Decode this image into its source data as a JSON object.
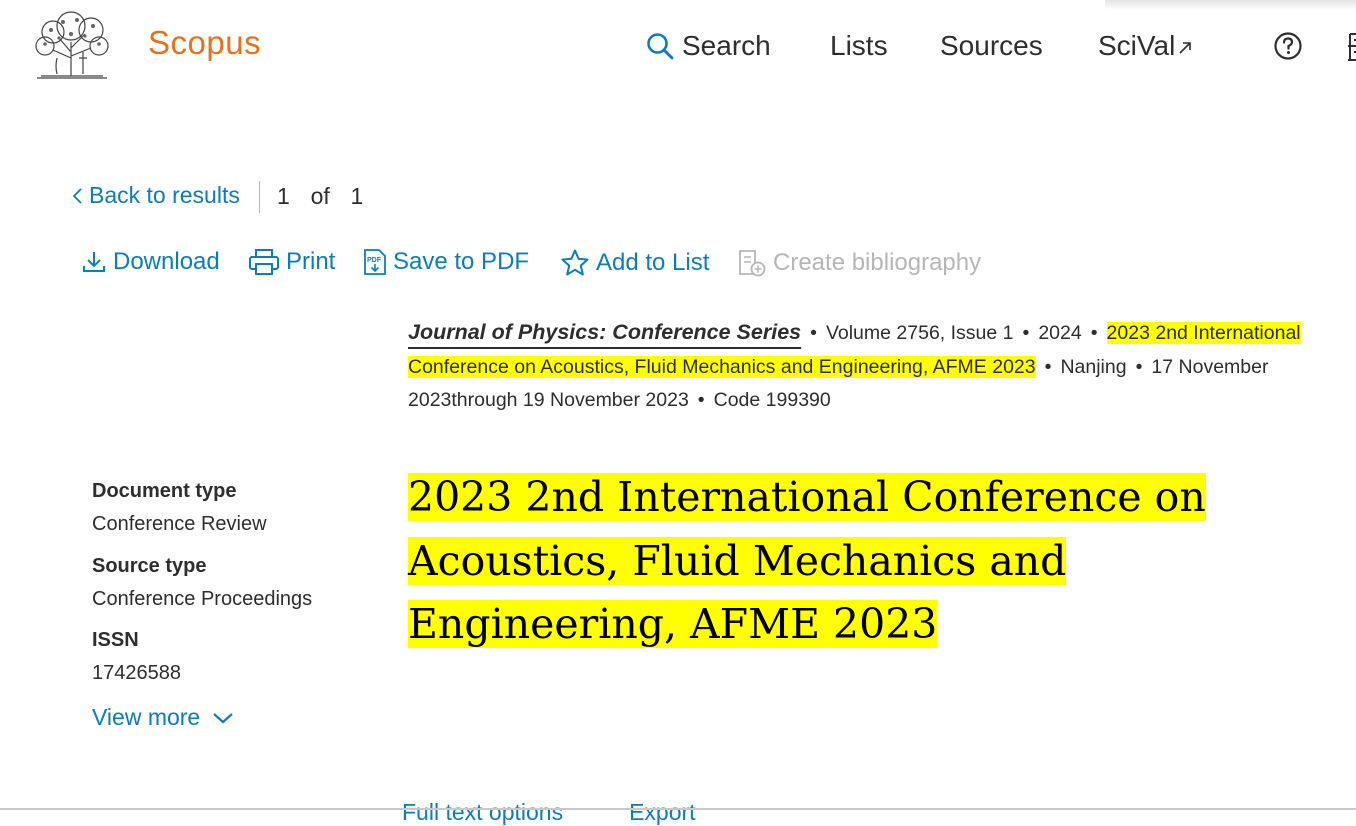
{
  "header": {
    "brand": "Scopus",
    "nav": [
      {
        "label": "Search",
        "icon": "search-icon"
      },
      {
        "label": "Lists"
      },
      {
        "label": "Sources"
      },
      {
        "label": "SciVal",
        "icon": "external-link-icon"
      }
    ],
    "help_icon": "help-icon",
    "institution_icon": "institution-icon"
  },
  "navigation": {
    "back_label": "Back to results",
    "pager": "1  of  1"
  },
  "toolbar": {
    "download": "Download",
    "print": "Print",
    "save_pdf": "Save to PDF",
    "add_to_list": "Add to List",
    "create_bibliography": "Create bibliography"
  },
  "source": {
    "journal": "Journal of Physics: Conference Series",
    "volume": "Volume 2756, Issue 1",
    "year": "2024",
    "conference": "2023 2nd International Conference on Acoustics, Fluid Mechanics and Engineering, AFME 2023",
    "location": "Nanjing",
    "dates": "17 November 2023through 19 November 2023",
    "code": "Code 199390"
  },
  "meta": {
    "document_type_label": "Document type",
    "document_type": "Conference Review",
    "source_type_label": "Source type",
    "source_type": "Conference Proceedings",
    "issn_label": "ISSN",
    "issn": "17426588",
    "view_more": "View more"
  },
  "document": {
    "title": "2023 2nd International Conference on Acoustics, Fluid Mechanics and Engineering, AFME 2023"
  },
  "bottom_actions": {
    "full_text": "Full text options",
    "export": "Export"
  },
  "colors": {
    "brand": "#e9711c",
    "link": "#0c7dbb",
    "highlight": "#ffff00",
    "disabled": "#b6b6b6"
  }
}
